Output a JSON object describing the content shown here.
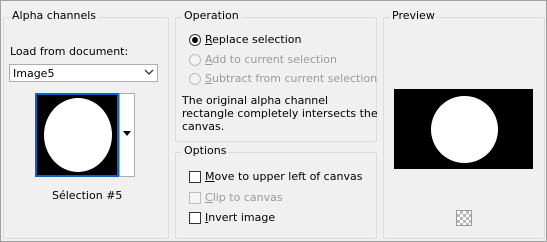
{
  "alpha_channels": {
    "title": "Alpha channels",
    "load_label": "Load from document:",
    "document_select": {
      "value": "Image5"
    },
    "selection_name": "Sélection #5"
  },
  "operation": {
    "title": "Operation",
    "options": [
      {
        "label": "Replace selection",
        "selected": true,
        "enabled": true
      },
      {
        "label": "Add to current selection",
        "selected": false,
        "enabled": false
      },
      {
        "label": "Subtract from current selection",
        "selected": false,
        "enabled": false
      }
    ],
    "info_lines": [
      "The original alpha channel",
      "rectangle completely intersects the",
      "canvas."
    ]
  },
  "options": {
    "title": "Options",
    "items": [
      {
        "label": "Move to upper left of canvas",
        "checked": false,
        "enabled": true
      },
      {
        "label": "Clip to canvas",
        "checked": false,
        "enabled": false
      },
      {
        "label": "Invert image",
        "checked": false,
        "enabled": true
      }
    ]
  },
  "preview": {
    "title": "Preview",
    "zoom_icon": "checkerboard-zoom-icon"
  }
}
